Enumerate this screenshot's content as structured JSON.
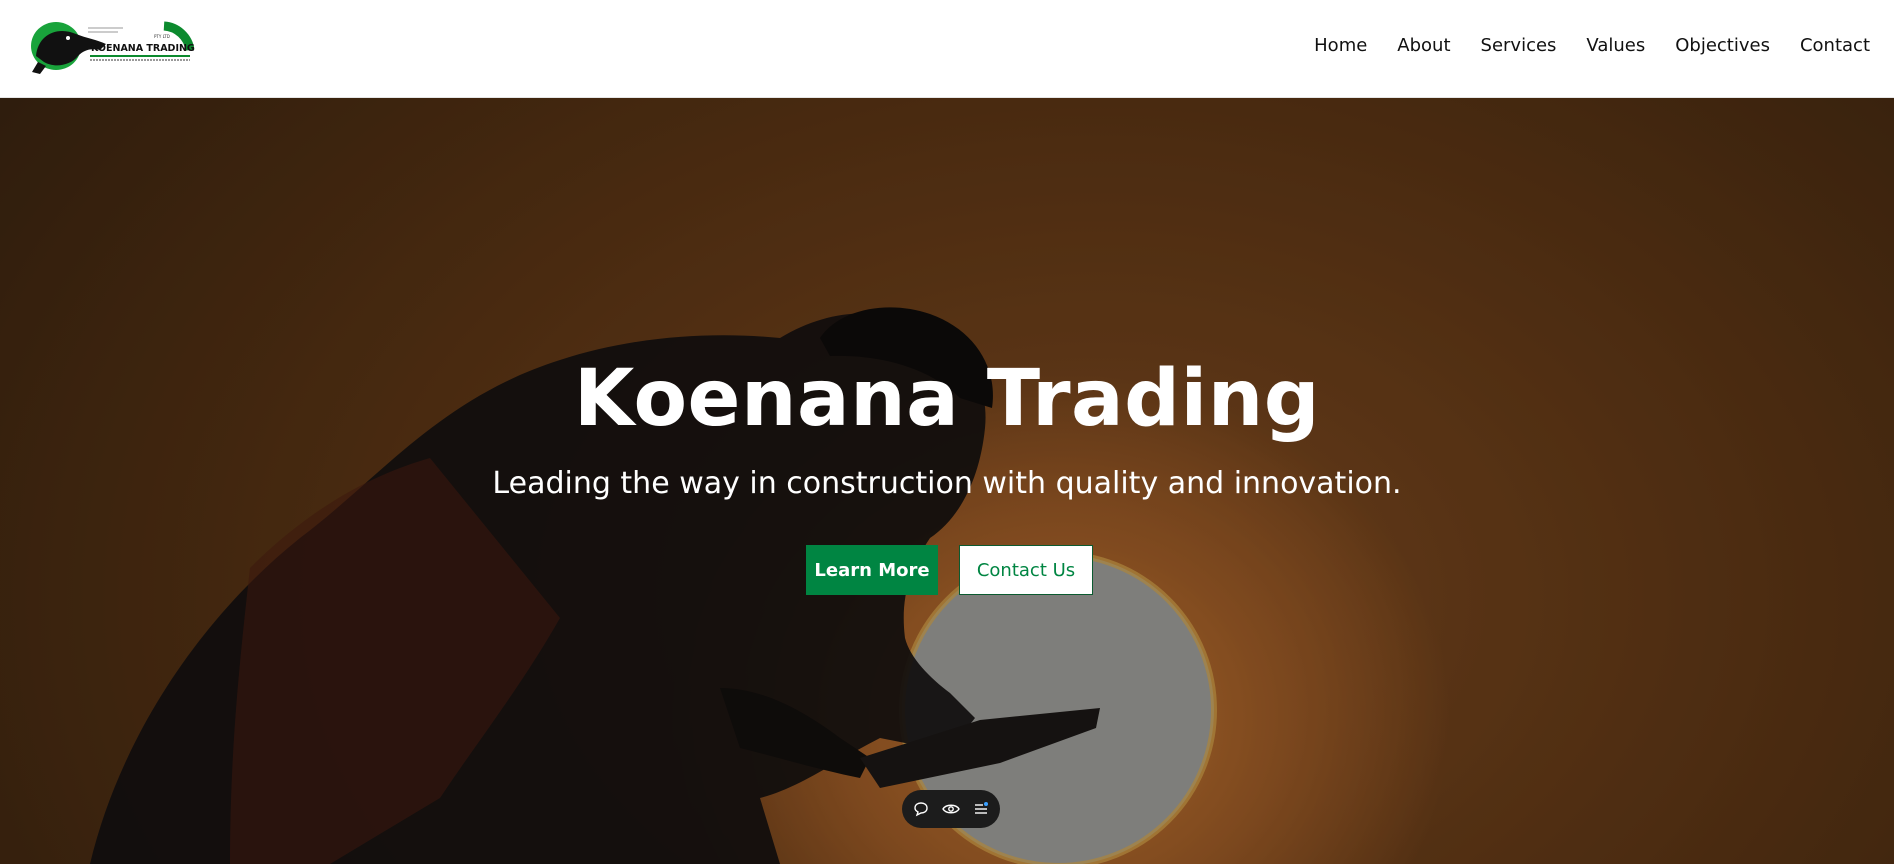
{
  "brand": {
    "logo_text": "KOENANA TRADING",
    "logo_small_text": "PTY LTD",
    "colors": {
      "green": "#008542",
      "dark": "#111111"
    }
  },
  "nav": {
    "items": [
      {
        "label": "Home"
      },
      {
        "label": "About"
      },
      {
        "label": "Services"
      },
      {
        "label": "Values"
      },
      {
        "label": "Objectives"
      },
      {
        "label": "Contact"
      }
    ]
  },
  "hero": {
    "title": "Koenana Trading",
    "subtitle": "Leading the way in construction with quality and innovation.",
    "primary_button": "Learn More",
    "secondary_button": "Contact Us"
  },
  "toolbar": {
    "icons": [
      "comment-icon",
      "eye-icon",
      "menu-icon"
    ]
  }
}
